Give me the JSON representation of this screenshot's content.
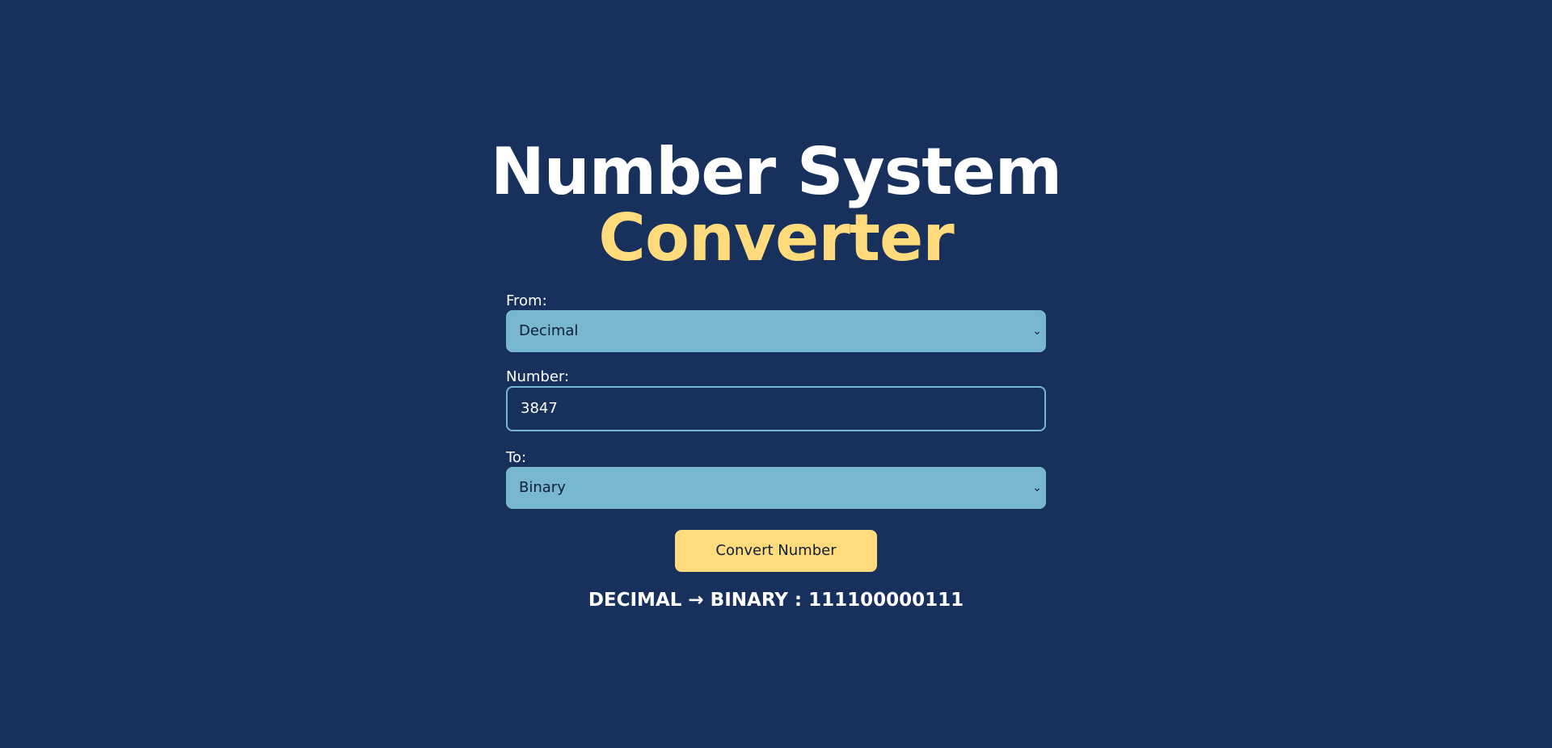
{
  "header": {
    "title_line1": "Number System",
    "title_line2": "Converter"
  },
  "form": {
    "from_label": "From:",
    "from_value": "Decimal",
    "number_label": "Number:",
    "number_value": "3847",
    "to_label": "To:",
    "to_value": "Binary"
  },
  "actions": {
    "convert_label": "Convert Number"
  },
  "result": {
    "text": "DECIMAL → BINARY : 111100000111"
  },
  "colors": {
    "background": "#17315c",
    "accent_yellow": "#ffdb7c",
    "select_blue": "#78b7d0",
    "text_white": "#ffffff"
  },
  "icons": {
    "select_chevron": "chevron-down-icon"
  }
}
